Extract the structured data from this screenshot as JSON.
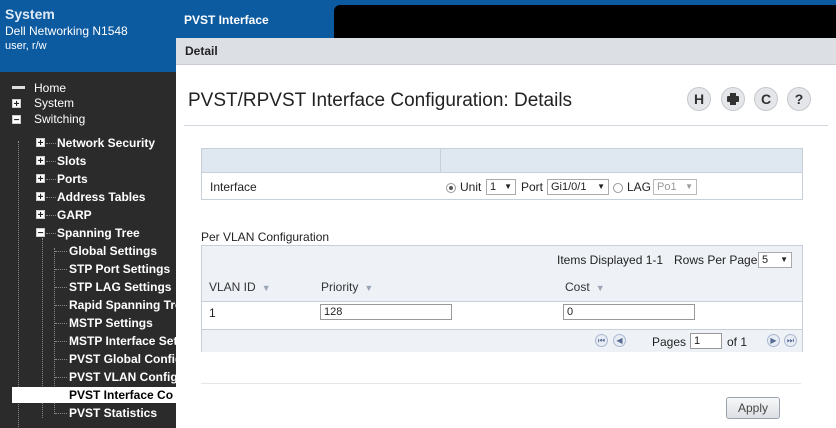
{
  "nav": {
    "system_title": "System",
    "model": "Dell Networking N1548",
    "user": "user, r/w",
    "items": {
      "home": "Home",
      "system": "System",
      "switching": "Switching",
      "network_security": "Network Security",
      "slots": "Slots",
      "ports": "Ports",
      "address_tables": "Address Tables",
      "garp": "GARP",
      "spanning_tree": "Spanning Tree",
      "global_settings": "Global Settings",
      "stp_port_settings": "STP Port Settings",
      "stp_lag_settings": "STP LAG Settings",
      "rapid_spanning_tree": "Rapid Spanning Tre",
      "mstp_settings": "MSTP Settings",
      "mstp_interface_settings": "MSTP Interface Sett",
      "pvst_global_config": "PVST Global Config",
      "pvst_vlan_config": "PVST VLAN Configu",
      "pvst_interface_config": "PVST Interface Co",
      "pvst_statistics": "PVST Statistics"
    }
  },
  "header": {
    "tab_label": "PVST Interface Configuration",
    "subtab_label": "Detail"
  },
  "page": {
    "title": "PVST/RPVST Interface Configuration: Details",
    "toolbar_icons": [
      "help-icon",
      "print-icon",
      "refresh-icon",
      "question-icon"
    ]
  },
  "interface": {
    "label": "Interface",
    "unit_label": "Unit",
    "unit_value": "1",
    "port_label": "Port",
    "port_value": "Gi1/0/1",
    "lag_label": "LAG",
    "lag_value": "Po1",
    "selected": "unit"
  },
  "vlan": {
    "section_title": "Per VLAN Configuration",
    "items_displayed": "Items Displayed 1-1",
    "rows_per_page_label": "Rows Per Page",
    "rows_per_page_value": "5",
    "columns": [
      "VLAN ID",
      "Priority",
      "Cost"
    ],
    "rows": [
      {
        "vlan_id": "1",
        "priority": "128",
        "cost": "0"
      }
    ],
    "pages_label": "Pages",
    "page_value": "1",
    "of_label": "of 1"
  },
  "apply_label": "Apply",
  "colors": {
    "brand_blue": "#0c5aa0",
    "nav_bg": "#2b2b2b"
  }
}
